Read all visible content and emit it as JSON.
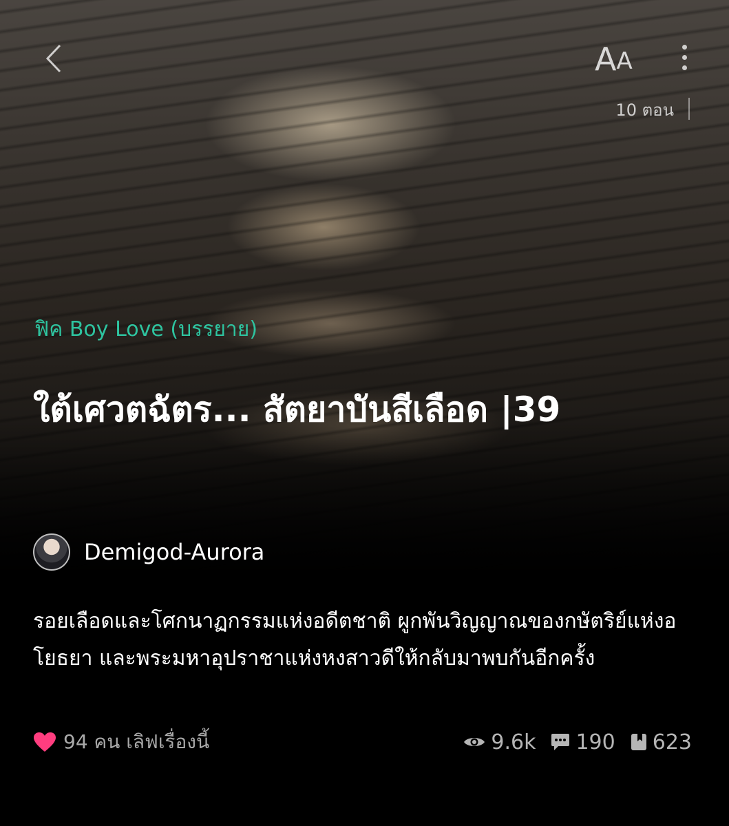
{
  "header": {
    "font_button_big": "A",
    "font_button_small": "A",
    "episodes": "10 ตอน"
  },
  "story": {
    "category": "ฟิค Boy Love (บรรยาย)",
    "title": "ใต้เศวตฉัตร... สัตยาบันสีเลือด |39",
    "author": "Demigod-Aurora",
    "synopsis": "รอยเลือดและโศกนาฏกรรมแห่งอดีตชาติ ผูกพันวิญญาณของกษัตริย์แห่งอโยธยา และพระมหาอุปราชาแห่งหงสาวดีให้กลับมาพบกันอีกครั้ง"
  },
  "footer": {
    "love_text": "94 คน เลิฟเรื่องนี้",
    "views": "9.6k",
    "comments": "190",
    "bookmarks": "623"
  },
  "colors": {
    "accent": "#2ec4a0",
    "heart": "#ff3d7f",
    "background": "#000000"
  },
  "icons": {
    "back": "chevron-left-icon",
    "more": "more-vertical-icon",
    "love": "heart-icon",
    "views": "eye-icon",
    "comments": "comment-icon",
    "bookmarks": "bookmark-icon"
  }
}
